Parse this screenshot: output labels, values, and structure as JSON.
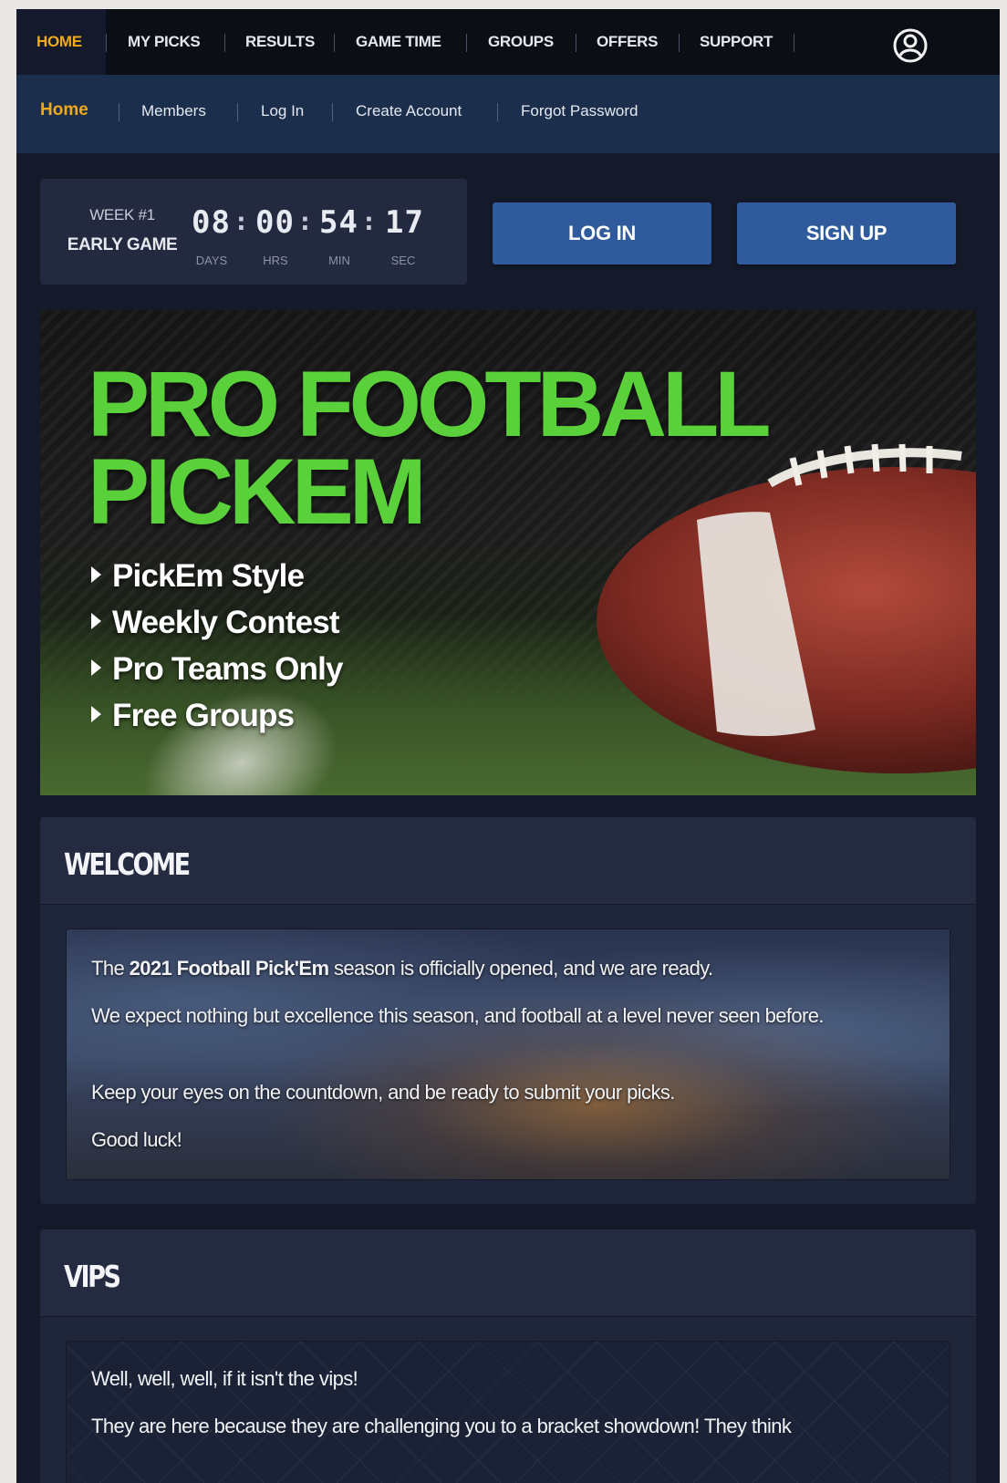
{
  "top_nav": {
    "items": [
      {
        "label": "HOME",
        "active": true
      },
      {
        "label": "MY PICKS"
      },
      {
        "label": "RESULTS"
      },
      {
        "label": "GAME TIME"
      },
      {
        "label": "GROUPS"
      },
      {
        "label": "OFFERS"
      },
      {
        "label": "SUPPORT"
      }
    ],
    "user_icon": "user-circle-icon"
  },
  "sub_nav": {
    "items": [
      {
        "label": "Home",
        "active": true
      },
      {
        "label": "Members"
      },
      {
        "label": "Log In"
      },
      {
        "label": "Create Account"
      },
      {
        "label": "Forgot Password"
      }
    ]
  },
  "countdown": {
    "week": "WEEK #1",
    "game": "EARLY GAME",
    "days": "08",
    "hrs": "00",
    "min": "54",
    "sec": "17",
    "days_label": "DAYS",
    "hrs_label": "HRS",
    "min_label": "MIN",
    "sec_label": "SEC"
  },
  "buttons": {
    "login": "LOG IN",
    "signup": "SIGN UP"
  },
  "hero": {
    "title_line1": "PRO FOOTBALL",
    "title_line2": "PICKEM",
    "features": [
      "PickEm Style",
      "Weekly Contest",
      "Pro Teams Only",
      "Free Groups"
    ]
  },
  "welcome": {
    "title": "WELCOME",
    "p1_pre": "The ",
    "p1_bold": "2021 Football Pick'Em",
    "p1_post": " season is officially opened, and we are ready.",
    "p2": "We expect nothing but excellence this season, and football at a level never seen before.",
    "p3": "Keep your eyes on the countdown, and be ready to submit your picks.",
    "p4": "Good luck!"
  },
  "vips": {
    "title": "VIPS",
    "p1": "Well, well, well, if it isn't the vips!",
    "p2": "They are here because they are challenging you to a bracket showdown! They think"
  },
  "colors": {
    "accent": "#f0a91b",
    "hero_green": "#5ad13b",
    "button_blue": "#2f5b9c",
    "page_bg": "#151a2b"
  }
}
